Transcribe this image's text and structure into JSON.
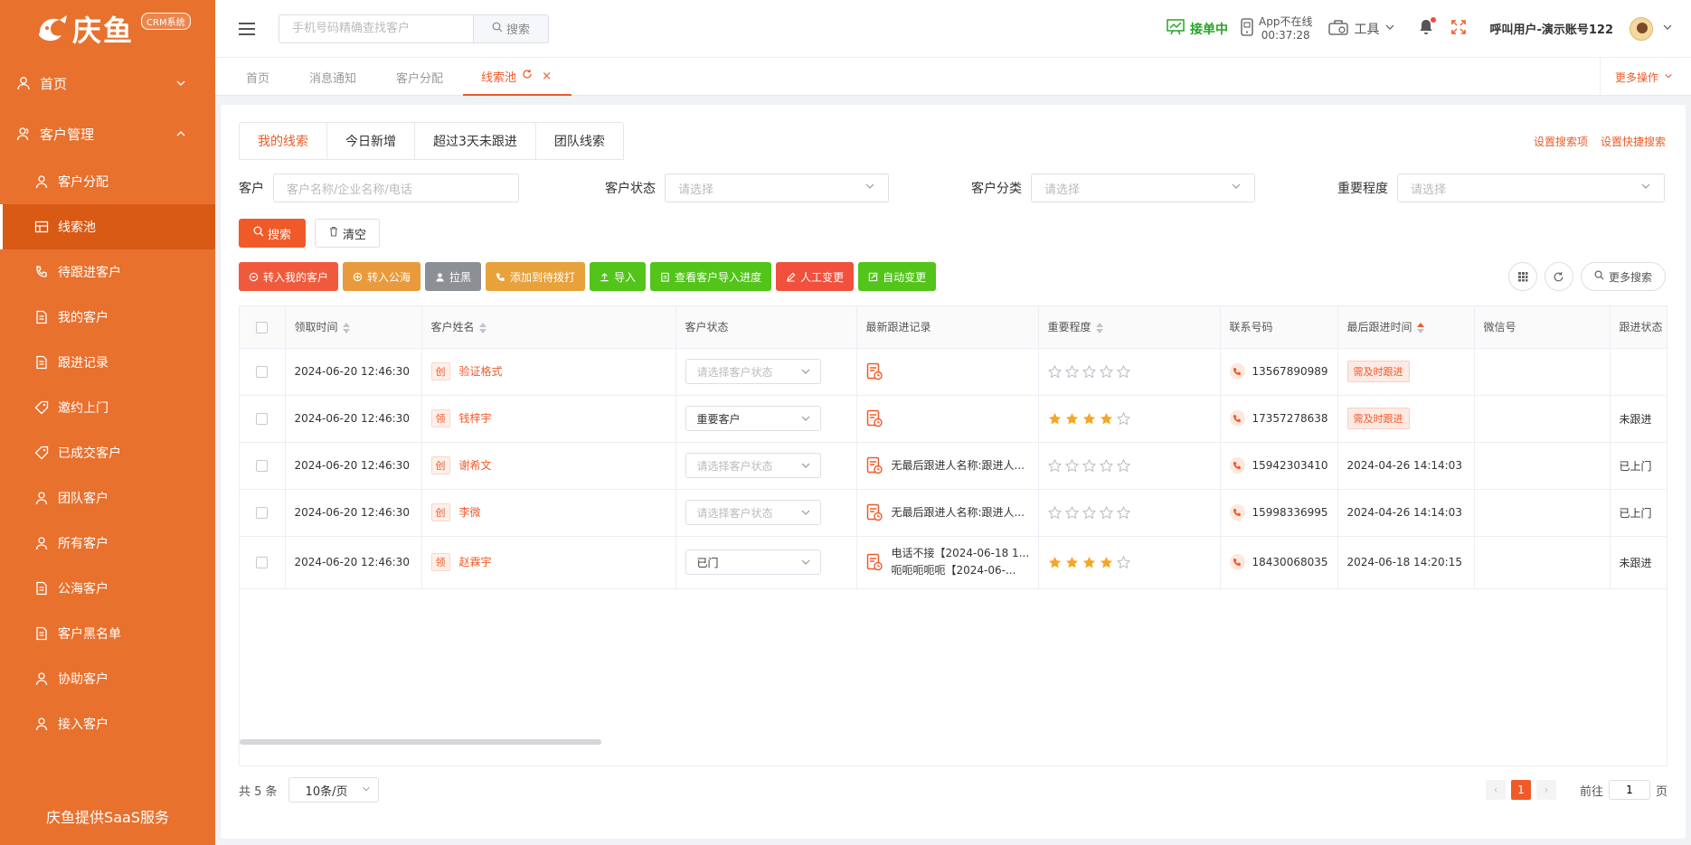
{
  "sidebar": {
    "logo_text": "庆鱼",
    "logo_badge": "CRM系统",
    "home": "首页",
    "customer_mgmt": "客户管理",
    "items": [
      {
        "label": "客户分配",
        "icon": "user-icon"
      },
      {
        "label": "线索池",
        "icon": "grid-icon",
        "active": true
      },
      {
        "label": "待跟进客户",
        "icon": "phone-icon"
      },
      {
        "label": "我的客户",
        "icon": "document-icon"
      },
      {
        "label": "跟进记录",
        "icon": "document-icon"
      },
      {
        "label": "邀约上门",
        "icon": "tag-icon"
      },
      {
        "label": "已成交客户",
        "icon": "tag-icon"
      },
      {
        "label": "团队客户",
        "icon": "user-icon"
      },
      {
        "label": "所有客户",
        "icon": "user-icon"
      },
      {
        "label": "公海客户",
        "icon": "document-icon"
      },
      {
        "label": "客户黑名单",
        "icon": "document-icon"
      },
      {
        "label": "协助客户",
        "icon": "user-icon"
      },
      {
        "label": "接入客户",
        "icon": "user-icon"
      }
    ],
    "footer": "庆鱼提供SaaS服务"
  },
  "header": {
    "search_placeholder": "手机号码精确查找客户",
    "search_button": "搜索",
    "receiving": "接单中",
    "app_status_line1": "App不在线",
    "app_status_line2": "00:37:28",
    "tools": "工具",
    "user_name": "呼叫用户-演示账号122"
  },
  "page_tabs": [
    {
      "label": "首页",
      "active": false
    },
    {
      "label": "消息通知",
      "active": false
    },
    {
      "label": "客户分配",
      "active": false
    },
    {
      "label": "线索池",
      "active": true
    }
  ],
  "more_ops": "更多操作",
  "sub_tabs": [
    "我的线索",
    "今日新增",
    "超过3天未跟进",
    "团队线索"
  ],
  "settings_links": [
    "设置搜索项",
    "设置快捷搜索"
  ],
  "filters": {
    "customer_label": "客户",
    "customer_placeholder": "客户名称/企业名称/电话",
    "status_label": "客户状态",
    "status_placeholder": "请选择",
    "category_label": "客户分类",
    "category_placeholder": "请选择",
    "importance_label": "重要程度",
    "importance_placeholder": "请选择"
  },
  "buttons": {
    "search": "搜索",
    "clear": "清空"
  },
  "toolbar": [
    {
      "label": "转入我的客户",
      "color": "#f05a3c"
    },
    {
      "label": "转入公海",
      "color": "#e89a3c"
    },
    {
      "label": "拉黑",
      "color": "#8c8f94"
    },
    {
      "label": "添加到待拨打",
      "color": "#e8a23c"
    },
    {
      "label": "导入",
      "color": "#52c41a"
    },
    {
      "label": "查看客户导入进度",
      "color": "#52c41a"
    },
    {
      "label": "人工变更",
      "color": "#f0503c"
    },
    {
      "label": "自动变更",
      "color": "#52c41a"
    }
  ],
  "more_search": "更多搜索",
  "table": {
    "columns": [
      "领取时间",
      "客户姓名",
      "客户状态",
      "最新跟进记录",
      "重要程度",
      "联系号码",
      "最后跟进时间",
      "微信号",
      "跟进状态"
    ],
    "rows": [
      {
        "time": "2024-06-20 12:46:30",
        "tag": "创",
        "name": "验证格式",
        "status": "请选择客户状态",
        "status_placeholder": true,
        "record": "",
        "record2": "",
        "stars": 0,
        "phone": "13567890989",
        "last_follow": "需及时跟进",
        "last_follow_badge": true,
        "wechat": "",
        "follow_status": ""
      },
      {
        "time": "2024-06-20 12:46:30",
        "tag": "领",
        "name": "钱梓宇",
        "status": "重要客户",
        "status_placeholder": false,
        "record": "",
        "record2": "",
        "stars": 4,
        "phone": "17357278638",
        "last_follow": "需及时跟进",
        "last_follow_badge": true,
        "wechat": "",
        "follow_status": "未跟进"
      },
      {
        "time": "2024-06-20 12:46:30",
        "tag": "创",
        "name": "谢希文",
        "status": "请选择客户状态",
        "status_placeholder": true,
        "record": "无最后跟进人名称:跟进人...",
        "record2": "",
        "stars": 0,
        "phone": "15942303410",
        "last_follow": "2024-04-26 14:14:03",
        "last_follow_badge": false,
        "wechat": "",
        "follow_status": "已上门"
      },
      {
        "time": "2024-06-20 12:46:30",
        "tag": "创",
        "name": "李微",
        "status": "请选择客户状态",
        "status_placeholder": true,
        "record": "无最后跟进人名称:跟进人...",
        "record2": "",
        "stars": 0,
        "phone": "15998336995",
        "last_follow": "2024-04-26 14:14:03",
        "last_follow_badge": false,
        "wechat": "",
        "follow_status": "已上门"
      },
      {
        "time": "2024-06-20 12:46:30",
        "tag": "领",
        "name": "赵霖宇",
        "status": "已门",
        "status_placeholder": false,
        "record": "电话不接【2024-06-18 1...",
        "record2": "呃呃呃呃呃【2024-06-...",
        "stars": 4,
        "phone": "18430068035",
        "last_follow": "2024-06-18 14:20:15",
        "last_follow_badge": false,
        "wechat": "",
        "follow_status": "未跟进"
      }
    ]
  },
  "pager": {
    "total": "共 5 条",
    "page_size": "10条/页",
    "current_page": "1",
    "goto_label": "前往",
    "goto_value": "1",
    "goto_unit": "页"
  },
  "colors": {
    "brand": "#e8712e",
    "accent": "#f05a28",
    "green": "#26a526",
    "star": "#f5a623"
  }
}
